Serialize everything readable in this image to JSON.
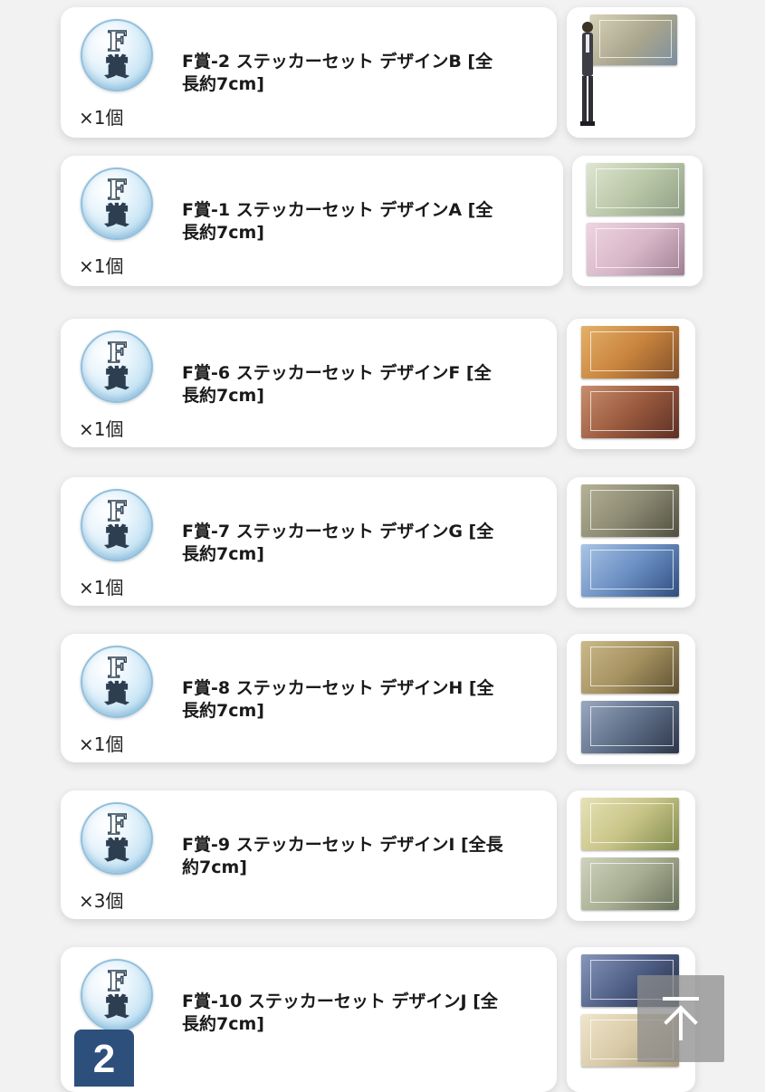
{
  "items": [
    {
      "badge_top": "F",
      "badge_bottom": "賞",
      "title": "F賞-2 ステッカーセット デザインB [全長約7cm]",
      "qty": "×1個",
      "thumb_colors": [
        "#c9c2a8",
        "#7a8fa0"
      ]
    },
    {
      "badge_top": "F",
      "badge_bottom": "賞",
      "title": "F賞-1 ステッカーセット デザインA [全長約7cm]",
      "qty": "×1個",
      "thumb_colors": [
        "#b9c7a7",
        "#d8b7c8"
      ]
    },
    {
      "badge_top": "F",
      "badge_bottom": "賞",
      "title": "F賞-6 ステッカーセット デザインF [全長約7cm]",
      "qty": "×1個",
      "thumb_colors": [
        "#c9843d",
        "#9a5a3e"
      ]
    },
    {
      "badge_top": "F",
      "badge_bottom": "賞",
      "title": "F賞-7 ステッカーセット デザインG [全長約7cm]",
      "qty": "×1個",
      "thumb_colors": [
        "#8c8a72",
        "#6b8fc2"
      ]
    },
    {
      "badge_top": "F",
      "badge_bottom": "賞",
      "title": "F賞-8 ステッカーセット デザインH [全長約7cm]",
      "qty": "×1個",
      "thumb_colors": [
        "#a59160",
        "#5f6f88"
      ]
    },
    {
      "badge_top": "F",
      "badge_bottom": "賞",
      "title": "F賞-9 ステッカーセット デザインI [全長約7cm]",
      "qty": "×3個",
      "thumb_colors": [
        "#c8c487",
        "#a7ae92"
      ]
    },
    {
      "badge_top": "F",
      "badge_bottom": "賞",
      "title": "F賞-10 ステッカーセット デザインJ [全長約7cm]",
      "qty": "",
      "thumb_colors": [
        "#4f5f86",
        "#d7c9a6"
      ]
    }
  ],
  "page_number": "2",
  "scroll_top_icon": "arrow-up-to-top-icon",
  "colors": {
    "background": "#f2f2f3",
    "card": "#ffffff",
    "badge_border": "#8fc0de",
    "page_badge": "#2d4f7c"
  }
}
